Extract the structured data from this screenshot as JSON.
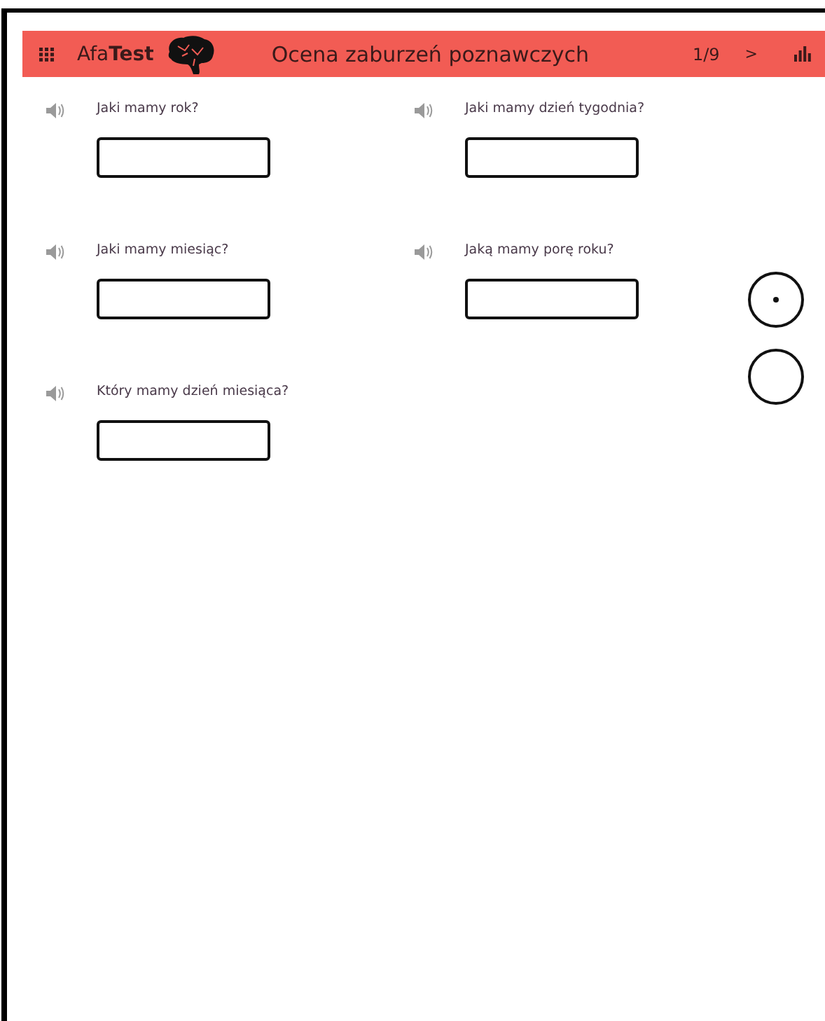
{
  "header": {
    "logo": "Afa**Test**",
    "title": "Ocena zaburzeń poznawczych",
    "progress": "1/9",
    "next": ">"
  },
  "questions": [
    {
      "label": "Jaki mamy rok?"
    },
    {
      "label": "Jaki mamy dzień tygodnia?"
    },
    {
      "label": "Jaki mamy miesiąc?"
    },
    {
      "label": "Jaką mamy porę roku?"
    },
    {
      "label": "Który mamy dzień miesiąca?"
    }
  ],
  "side_buttons": [
    {
      "kind": "dot"
    },
    {
      "kind": "plain"
    }
  ]
}
